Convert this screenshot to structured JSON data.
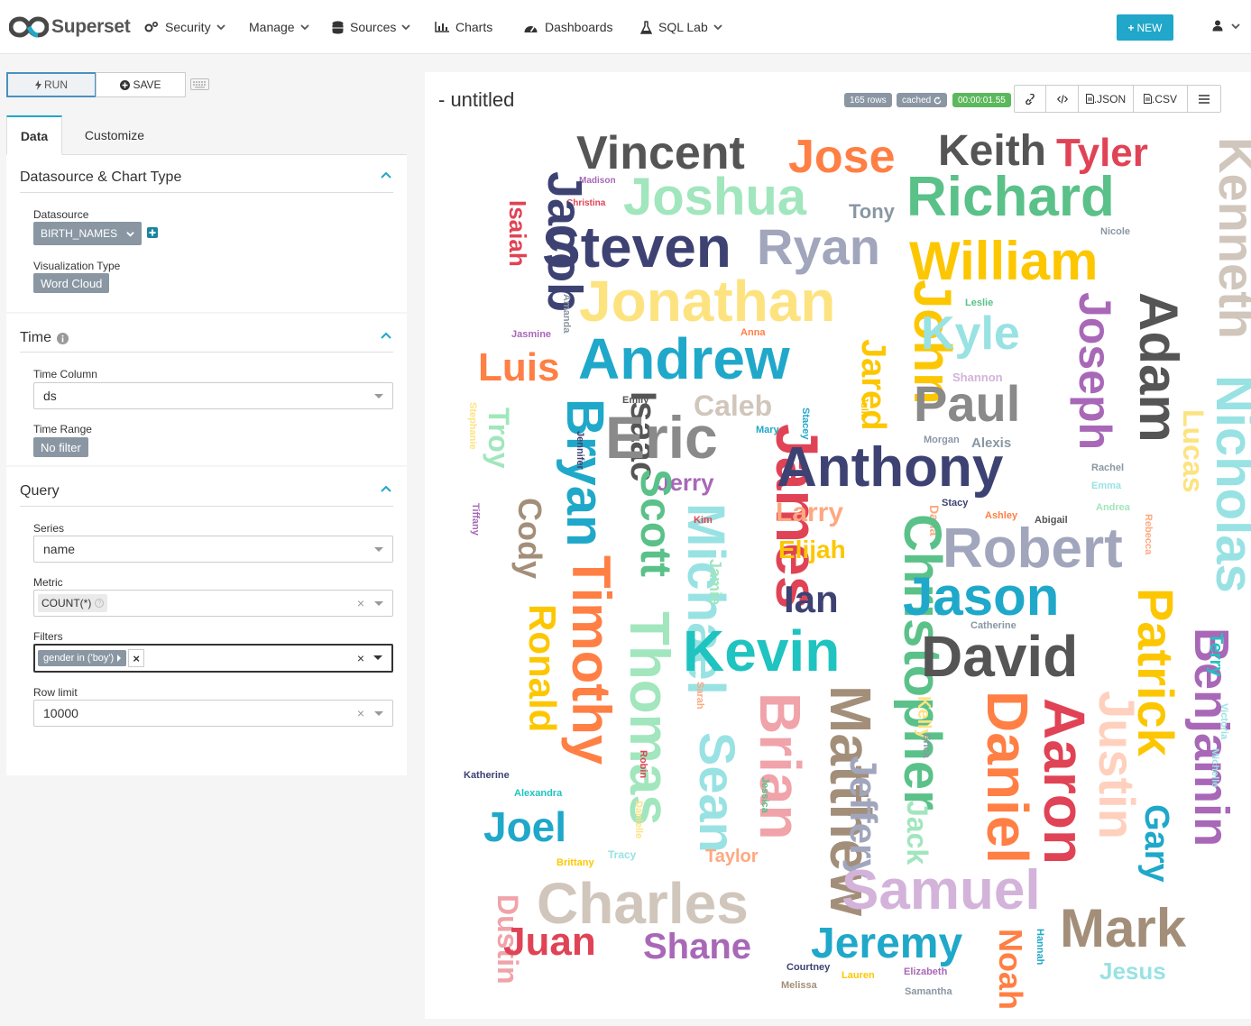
{
  "brand": {
    "name": "Superset"
  },
  "nav": {
    "security": "Security",
    "manage": "Manage",
    "sources": "Sources",
    "charts": "Charts",
    "dashboards": "Dashboards",
    "sql_lab": "SQL Lab",
    "new_label": "NEW"
  },
  "toolbar": {
    "run_label": "RUN",
    "save_label": "SAVE"
  },
  "tabs": {
    "data": "Data",
    "customize": "Customize"
  },
  "sections": {
    "datasource": {
      "title": "Datasource & Chart Type",
      "datasource_label": "Datasource",
      "datasource_value": "BIRTH_NAMES",
      "viz_label": "Visualization Type",
      "viz_value": "Word Cloud"
    },
    "time": {
      "title": "Time",
      "column_label": "Time Column",
      "column_value": "ds",
      "range_label": "Time Range",
      "range_value": "No filter"
    },
    "query": {
      "title": "Query",
      "series_label": "Series",
      "series_value": "name",
      "metric_label": "Metric",
      "metric_value": "COUNT(*)",
      "filters_label": "Filters",
      "filters_value": "gender in ('boy')",
      "row_limit_label": "Row limit",
      "row_limit_value": "10000"
    }
  },
  "chart": {
    "title": "- untitled",
    "rows_badge": "165 rows",
    "cached_badge": "cached",
    "timer_badge": "00:00:01.55",
    "json_label": ".JSON",
    "csv_label": ".CSV"
  },
  "colors": {
    "accent": "#20a7c9",
    "badge_gray": "#8a97a3",
    "timer_green": "#5cb85c"
  },
  "chart_data": {
    "type": "wordcloud",
    "words": [
      {
        "text": "Vincent",
        "color": "#555555"
      },
      {
        "text": "Jose",
        "color": "#ff7f44"
      },
      {
        "text": "Keith",
        "color": "#555555"
      },
      {
        "text": "Tyler",
        "color": "#e04355"
      },
      {
        "text": "Kenneth",
        "color": "#d1c6bc"
      },
      {
        "text": "Madison",
        "color": "#a868b7"
      },
      {
        "text": "Christina",
        "color": "#e04355"
      },
      {
        "text": "Joshua",
        "color": "#a1e6bd"
      },
      {
        "text": "Tony",
        "color": "#8a97a3"
      },
      {
        "text": "Richard",
        "color": "#5ac189"
      },
      {
        "text": "Jacob",
        "color": "#3d4273"
      },
      {
        "text": "Isaiah",
        "color": "#e04355"
      },
      {
        "text": "Steven",
        "color": "#3d4273"
      },
      {
        "text": "Ryan",
        "color": "#a1a6bd"
      },
      {
        "text": "Nicole",
        "color": "#8a97a3"
      },
      {
        "text": "William",
        "color": "#fcc700"
      },
      {
        "text": "Jonathan",
        "color": "#fde380"
      },
      {
        "text": "John",
        "color": "#fcc700"
      },
      {
        "text": "Leslie",
        "color": "#5ac189"
      },
      {
        "text": "Joseph",
        "color": "#a868b7"
      },
      {
        "text": "Adam",
        "color": "#555555"
      },
      {
        "text": "Amanda",
        "color": "#8a97a3"
      },
      {
        "text": "Jasmine",
        "color": "#a868b7"
      },
      {
        "text": "Anna",
        "color": "#ff7f44"
      },
      {
        "text": "Kyle",
        "color": "#99e2e3"
      },
      {
        "text": "Luis",
        "color": "#ff7f44"
      },
      {
        "text": "Andrew",
        "color": "#1fa8c9"
      },
      {
        "text": "Jared",
        "color": "#fcc700"
      },
      {
        "text": "Shannon",
        "color": "#d3b3da"
      },
      {
        "text": "Nicholas",
        "color": "#99e2e3"
      },
      {
        "text": "Lucas",
        "color": "#fde380"
      },
      {
        "text": "Emily",
        "color": "#555555"
      },
      {
        "text": "Isaac",
        "color": "#555555"
      },
      {
        "text": "Caleb",
        "color": "#d1c6bc"
      },
      {
        "text": "Julia",
        "color": "#fcc700"
      },
      {
        "text": "Paul",
        "color": "#8a8a8a"
      },
      {
        "text": "Stephanie",
        "color": "#fde380"
      },
      {
        "text": "Troy",
        "color": "#a1e6bd"
      },
      {
        "text": "Bryan",
        "color": "#1fa8c9"
      },
      {
        "text": "Eric",
        "color": "#8a8a8a"
      },
      {
        "text": "Mary",
        "color": "#1fa8c9"
      },
      {
        "text": "Stacey",
        "color": "#1fa8c9"
      },
      {
        "text": "Morgan",
        "color": "#8a97a3"
      },
      {
        "text": "Alexis",
        "color": "#8a97a3"
      },
      {
        "text": "Jennifer",
        "color": "#3d4273"
      },
      {
        "text": "James",
        "color": "#e04355"
      },
      {
        "text": "Anthony",
        "color": "#3d4273"
      },
      {
        "text": "Rachel",
        "color": "#8a97a3"
      },
      {
        "text": "Emma",
        "color": "#99e2e3"
      },
      {
        "text": "Jerry",
        "color": "#a868b7"
      },
      {
        "text": "Scott",
        "color": "#5ac189"
      },
      {
        "text": "Andrea",
        "color": "#a1e6bd"
      },
      {
        "text": "Stacy",
        "color": "#3d4273"
      },
      {
        "text": "Tiffany",
        "color": "#a868b7"
      },
      {
        "text": "Cody",
        "color": "#a38f79"
      },
      {
        "text": "Michael",
        "color": "#99e2e3"
      },
      {
        "text": "Kim",
        "color": "#e04355"
      },
      {
        "text": "Larry",
        "color": "#ffa880"
      },
      {
        "text": "Dana",
        "color": "#ffa880"
      },
      {
        "text": "Ashley",
        "color": "#ff7f44"
      },
      {
        "text": "Abigail",
        "color": "#555555"
      },
      {
        "text": "Rebecca",
        "color": "#ffa880"
      },
      {
        "text": "Elijah",
        "color": "#fcc700"
      },
      {
        "text": "Christopher",
        "color": "#5ac189"
      },
      {
        "text": "Robert",
        "color": "#a1a6bd"
      },
      {
        "text": "Timothy",
        "color": "#ff7f44"
      },
      {
        "text": "Jamie",
        "color": "#a1e6bd"
      },
      {
        "text": "Ian",
        "color": "#3d4273"
      },
      {
        "text": "Jason",
        "color": "#1fa8c9"
      },
      {
        "text": "Ronald",
        "color": "#fcc700"
      },
      {
        "text": "Thomas",
        "color": "#a1e6bd"
      },
      {
        "text": "Catherine",
        "color": "#8a97a3"
      },
      {
        "text": "Kevin",
        "color": "#1fc3c0"
      },
      {
        "text": "David",
        "color": "#555555"
      },
      {
        "text": "Patrick",
        "color": "#fcc700"
      },
      {
        "text": "Benjamin",
        "color": "#a868b7"
      },
      {
        "text": "Terry",
        "color": "#1fc3c0"
      },
      {
        "text": "Sarah",
        "color": "#ffa880"
      },
      {
        "text": "Brian",
        "color": "#f0a3a9"
      },
      {
        "text": "Matthew",
        "color": "#a38f79"
      },
      {
        "text": "Kelly",
        "color": "#fde380"
      },
      {
        "text": "Daniel",
        "color": "#ff7f44"
      },
      {
        "text": "Aaron",
        "color": "#e04355"
      },
      {
        "text": "Justin",
        "color": "#ffd0bd"
      },
      {
        "text": "Victoria",
        "color": "#99e2e3"
      },
      {
        "text": "Michelle",
        "color": "#99e2e3"
      },
      {
        "text": "Robin",
        "color": "#e04355"
      },
      {
        "text": "Erica",
        "color": "#8a97a3"
      },
      {
        "text": "Katherine",
        "color": "#3d4273"
      },
      {
        "text": "Alexandra",
        "color": "#1fc3c0"
      },
      {
        "text": "Jeffery",
        "color": "#a1a6bd"
      },
      {
        "text": "Sean",
        "color": "#99e2e3"
      },
      {
        "text": "Jessica",
        "color": "#5ac189"
      },
      {
        "text": "Danielle",
        "color": "#fde380"
      },
      {
        "text": "Jack",
        "color": "#a1e6bd"
      },
      {
        "text": "Gary",
        "color": "#1fa8c9"
      },
      {
        "text": "Joel",
        "color": "#1fa8c9"
      },
      {
        "text": "Brittany",
        "color": "#fcc700"
      },
      {
        "text": "Tracy",
        "color": "#99e2e3"
      },
      {
        "text": "Taylor",
        "color": "#ffa880"
      },
      {
        "text": "Charles",
        "color": "#d1c6bc"
      },
      {
        "text": "Samuel",
        "color": "#d3b3da"
      },
      {
        "text": "Mark",
        "color": "#a38f79"
      },
      {
        "text": "Dustin",
        "color": "#f0a3a9"
      },
      {
        "text": "Juan",
        "color": "#e04355"
      },
      {
        "text": "Shane",
        "color": "#a868b7"
      },
      {
        "text": "Jeremy",
        "color": "#1fa8c9"
      },
      {
        "text": "Noah",
        "color": "#ff7f44"
      },
      {
        "text": "Hannah",
        "color": "#1fa8c9"
      },
      {
        "text": "Jesus",
        "color": "#99e2e3"
      },
      {
        "text": "Courtney",
        "color": "#3d4273"
      },
      {
        "text": "Lauren",
        "color": "#fcc700"
      },
      {
        "text": "Elizabeth",
        "color": "#a868b7"
      },
      {
        "text": "Melissa",
        "color": "#a38f79"
      },
      {
        "text": "Samantha",
        "color": "#8a97a3"
      }
    ]
  }
}
